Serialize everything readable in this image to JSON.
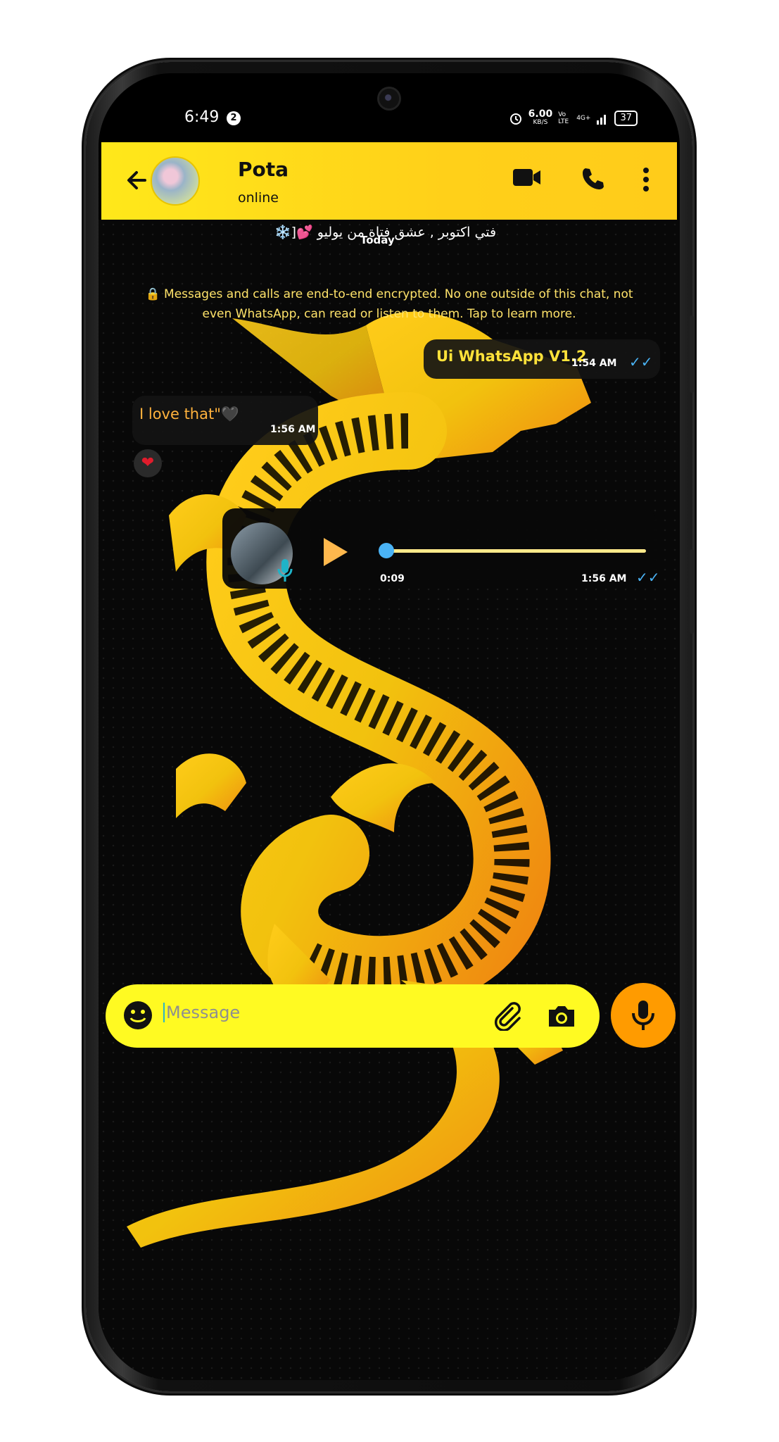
{
  "status_bar": {
    "time": "6:49",
    "notification_count": "2",
    "net_speed": "6.00",
    "net_unit": "KB/S",
    "volte": "Vo LTE",
    "network": "4G+",
    "battery": "37"
  },
  "header": {
    "contact_name": "Pota",
    "contact_status": "online"
  },
  "chat": {
    "pinned_text": "فتي اكتوبر , عشق فتاة من يوليو 💕[❄️",
    "date_divider": "Today",
    "encryption_notice": "🔒 Messages and calls are end-to-end encrypted. No one outside of this chat, not even WhatsApp, can read or listen to them. Tap to learn more.",
    "messages": [
      {
        "direction": "outgoing",
        "text": "Ui WhatsApp V1.2",
        "time": "1:54 AM",
        "status": "✓✓"
      },
      {
        "direction": "incoming",
        "text": "I love that\"🖤",
        "time": "1:56 AM",
        "reaction": "❤"
      },
      {
        "direction": "outgoing",
        "type": "voice",
        "duration": "0:09",
        "time": "1:56 AM",
        "status": "✓✓",
        "progress": 0
      }
    ]
  },
  "composer": {
    "placeholder": "Message"
  },
  "colors": {
    "accent_yellow": "#ffe81a",
    "input_yellow": "#fffa22",
    "mic_orange": "#ff9b00",
    "read_tick_blue": "#4ab3f5"
  },
  "icons": [
    "back-arrow-icon",
    "video-call-icon",
    "phone-icon",
    "more-vert-icon",
    "emoji-icon",
    "attach-icon",
    "camera-icon",
    "mic-icon",
    "play-icon",
    "lock-icon"
  ]
}
